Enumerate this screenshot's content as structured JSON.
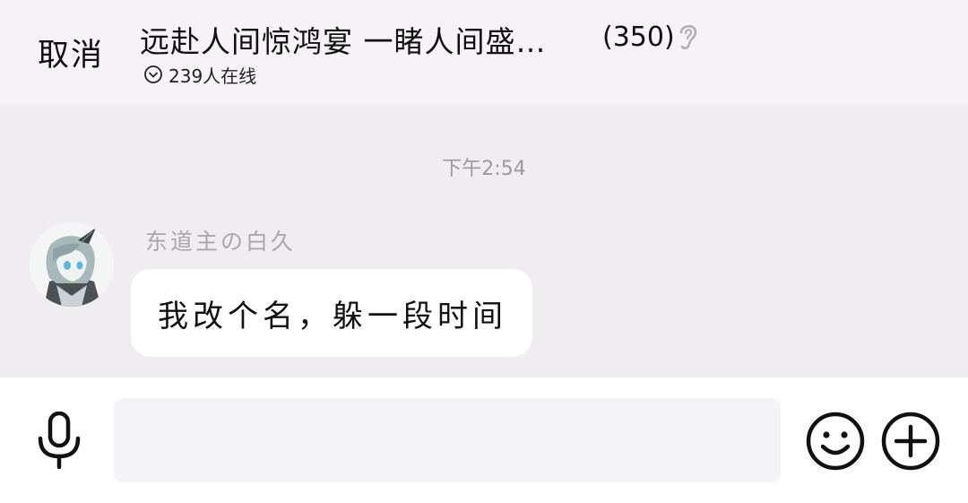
{
  "header": {
    "cancel_label": "取消",
    "title": "远赴人间惊鸿宴  一睹人间盛…",
    "member_count": "(350)",
    "online_text": "239人在线",
    "ear_icon": "ear-icon",
    "online_icon": "chevron-down-circle-icon"
  },
  "chat": {
    "timestamp": "下午2:54",
    "messages": [
      {
        "sender": "东道主の白久",
        "text": "我改个名，躲一段时间",
        "avatar_icon": "avatar"
      }
    ]
  },
  "input_bar": {
    "placeholder": "",
    "mic_icon": "microphone-icon",
    "emoji_icon": "emoji-icon",
    "plus_icon": "plus-icon"
  },
  "colors": {
    "background": "#f5f3f5",
    "chat_background": "#efedef",
    "bubble": "#ffffff",
    "muted_text": "#a8a8a8"
  }
}
